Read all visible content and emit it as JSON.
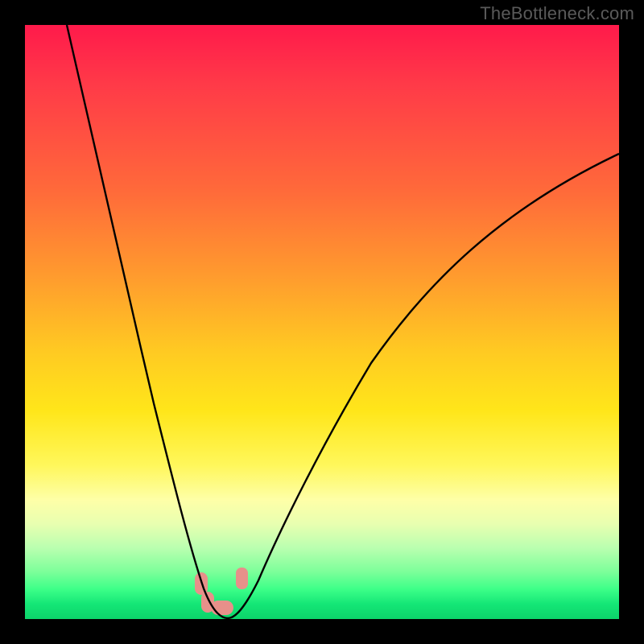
{
  "watermark": "TheBottleneck.com",
  "chart_data": {
    "type": "line",
    "title": "",
    "xlabel": "",
    "ylabel": "",
    "xlim": [
      0,
      100
    ],
    "ylim": [
      0,
      100
    ],
    "grid": false,
    "legend": false,
    "series": [
      {
        "name": "bottleneck-curve",
        "color": "#000000",
        "x": [
          7,
          10,
          13,
          16,
          19,
          22,
          25,
          27,
          29,
          30,
          31,
          32,
          33,
          34,
          36,
          40,
          45,
          50,
          55,
          60,
          65,
          70,
          75,
          80,
          85,
          90,
          95,
          100
        ],
        "y": [
          100,
          90,
          80,
          70,
          60,
          49,
          37,
          27,
          17,
          11,
          6,
          3,
          1,
          0,
          1,
          6,
          15,
          24,
          32,
          40,
          47,
          53,
          59,
          64,
          68,
          72,
          75,
          78
        ]
      }
    ],
    "annotations": [
      {
        "name": "marker-cluster",
        "approx_x": 32,
        "approx_y": 2,
        "color": "#e7908a"
      }
    ],
    "background_gradient": {
      "direction": "vertical",
      "stops": [
        {
          "pos": 0.0,
          "color": "#ff1a4b"
        },
        {
          "pos": 0.28,
          "color": "#ff6a3a"
        },
        {
          "pos": 0.55,
          "color": "#ffca22"
        },
        {
          "pos": 0.8,
          "color": "#feffa8"
        },
        {
          "pos": 0.92,
          "color": "#7dff9a"
        },
        {
          "pos": 1.0,
          "color": "#0cd46a"
        }
      ]
    }
  }
}
